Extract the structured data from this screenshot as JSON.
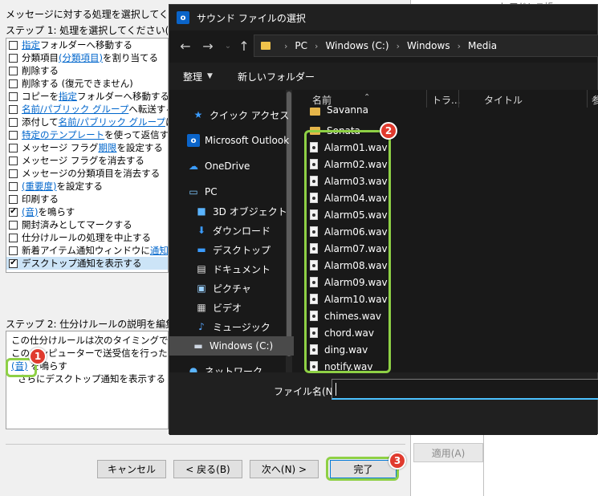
{
  "wizard": {
    "prompt": "メッセージに対する処理を選択してください",
    "step1_label": "ステップ 1: 処理を選択してください(C)",
    "actions": [
      {
        "checked": false,
        "parts": [
          {
            "link": "指定"
          },
          {
            "text": " フォルダーへ移動する"
          }
        ]
      },
      {
        "checked": false,
        "parts": [
          {
            "text": "分類項目 "
          },
          {
            "link": "(分類項目)"
          },
          {
            "text": " を割り当てる"
          }
        ]
      },
      {
        "checked": false,
        "parts": [
          {
            "text": "削除する"
          }
        ]
      },
      {
        "checked": false,
        "parts": [
          {
            "text": "削除する (復元できません)"
          }
        ]
      },
      {
        "checked": false,
        "parts": [
          {
            "text": "コピーを "
          },
          {
            "link": "指定"
          },
          {
            "text": " フォルダーへ移動する"
          }
        ]
      },
      {
        "checked": false,
        "parts": [
          {
            "link": "名前/パブリック グループ"
          },
          {
            "text": " へ転送する"
          }
        ]
      },
      {
        "checked": false,
        "parts": [
          {
            "text": "添付して "
          },
          {
            "link": "名前/パブリック グループ"
          },
          {
            "text": " に転送"
          }
        ]
      },
      {
        "checked": false,
        "parts": [
          {
            "link": "特定のテンプレート"
          },
          {
            "text": " を使って返信する"
          }
        ]
      },
      {
        "checked": false,
        "parts": [
          {
            "text": "メッセージ フラグ "
          },
          {
            "link": "期限"
          },
          {
            "text": " を設定する"
          }
        ]
      },
      {
        "checked": false,
        "parts": [
          {
            "text": "メッセージ フラグを消去する"
          }
        ]
      },
      {
        "checked": false,
        "parts": [
          {
            "text": "メッセージの分類項目を消去する"
          }
        ]
      },
      {
        "checked": false,
        "parts": [
          {
            "link": "(重要度)"
          },
          {
            "text": " を設定する"
          }
        ]
      },
      {
        "checked": false,
        "parts": [
          {
            "text": "印刷する"
          }
        ]
      },
      {
        "checked": true,
        "parts": [
          {
            "link": "(音)"
          },
          {
            "text": " を鳴らす"
          }
        ]
      },
      {
        "checked": false,
        "parts": [
          {
            "text": "開封済みとしてマークする"
          }
        ]
      },
      {
        "checked": false,
        "parts": [
          {
            "text": "仕分けルールの処理を中止する"
          }
        ]
      },
      {
        "checked": false,
        "parts": [
          {
            "text": "新着アイテム通知ウィンドウに "
          },
          {
            "link": "通知メッセ"
          }
        ]
      },
      {
        "checked": true,
        "selected": true,
        "parts": [
          {
            "text": "デスクトップ通知を表示する"
          }
        ]
      }
    ],
    "step2_label": "ステップ 2: 仕分けルールの説明を編集して",
    "description": {
      "line1": "この仕分けルールは次のタイミングで適用さ",
      "line2": "このコンピューターで送受信を行った場合の",
      "sound_link": "(音)",
      "line3_rest": " を鳴らす",
      "line4": "さらにデスクトップ通知を表示する"
    },
    "buttons": {
      "cancel": "キャンセル",
      "back": "< 戻る(B)",
      "next": "次へ(N) >",
      "finish": "完了"
    }
  },
  "background_window": {
    "apply": "適用(A)",
    "top_text": "× ホ アドレス帳"
  },
  "file_dialog": {
    "title": "サウンド ファイルの選択",
    "breadcrumb": [
      "PC",
      "Windows (C:)",
      "Windows",
      "Media"
    ],
    "toolbar": {
      "organize": "整理",
      "new_folder": "新しいフォルダー"
    },
    "nav_items": [
      {
        "label": "クイック アクセス",
        "icon": "star-icon"
      },
      {
        "label": "Microsoft Outlook",
        "icon": "outlook-icon"
      },
      {
        "label": "OneDrive",
        "icon": "cloud-icon"
      },
      {
        "label": "PC",
        "icon": "computer-icon"
      },
      {
        "label": "3D オブジェクト",
        "icon": "cube-icon"
      },
      {
        "label": "ダウンロード",
        "icon": "download-icon"
      },
      {
        "label": "デスクトップ",
        "icon": "desktop-icon"
      },
      {
        "label": "ドキュメント",
        "icon": "document-icon"
      },
      {
        "label": "ピクチャ",
        "icon": "picture-icon"
      },
      {
        "label": "ビデオ",
        "icon": "video-icon"
      },
      {
        "label": "ミュージック",
        "icon": "music-icon"
      },
      {
        "label": "Windows (C:)",
        "icon": "drive-icon",
        "selected": true
      },
      {
        "label": "ネットワーク",
        "icon": "network-icon"
      }
    ],
    "columns": [
      "名前",
      "トラ...",
      "タイトル",
      "参"
    ],
    "folders": [
      "Savanna",
      "Sonata"
    ],
    "files": [
      "Alarm01.wav",
      "Alarm02.wav",
      "Alarm03.wav",
      "Alarm04.wav",
      "Alarm05.wav",
      "Alarm06.wav",
      "Alarm07.wav",
      "Alarm08.wav",
      "Alarm09.wav",
      "Alarm10.wav",
      "chimes.wav",
      "chord.wav",
      "ding.wav",
      "notify.wav"
    ],
    "filename_label": "ファイル名(N):",
    "filename_value": ""
  },
  "annotations": {
    "badge1": "1",
    "badge2": "2",
    "badge3": "3",
    "highlight_color": "#8ed045",
    "badge_color": "#e03a2e"
  }
}
